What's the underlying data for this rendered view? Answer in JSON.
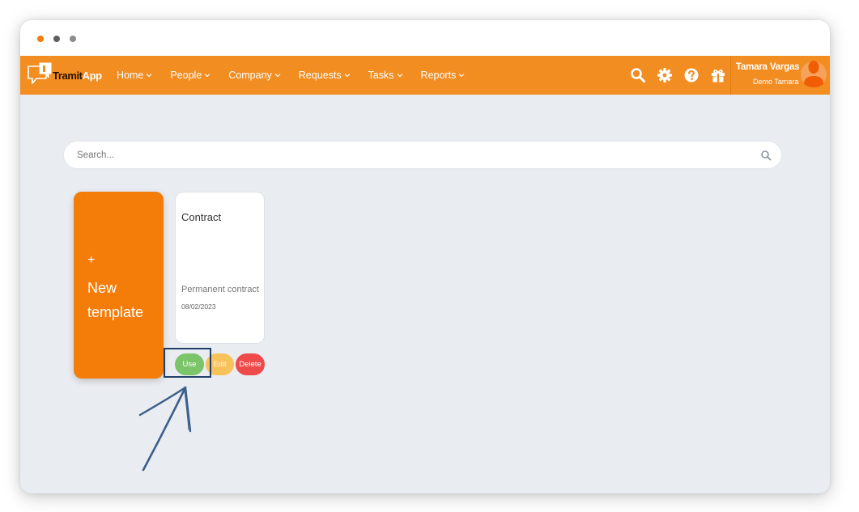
{
  "window": {
    "traffic_lights": [
      "#f07c0b",
      "#5e5e5e",
      "#8c8c8c"
    ]
  },
  "brand": {
    "name_part1": "Tramit",
    "name_part2": "App",
    "color": "#f28d22"
  },
  "nav": {
    "items": [
      {
        "label": "Home",
        "icon": "chevron-down-icon"
      },
      {
        "label": "People",
        "icon": "chevron-down-icon"
      },
      {
        "label": "Company",
        "icon": "chevron-down-icon"
      },
      {
        "label": "Requests",
        "icon": "chevron-down-icon"
      },
      {
        "label": "Tasks",
        "icon": "chevron-down-icon"
      },
      {
        "label": "Reports",
        "icon": "chevron-down-icon"
      }
    ],
    "icons": [
      "search-icon",
      "gear-icon",
      "help-icon",
      "gift-icon"
    ]
  },
  "user": {
    "name": "Tamara Vargas",
    "org": "Demo Tamara",
    "avatar_icon": "user-avatar-icon"
  },
  "search": {
    "placeholder": "Search...",
    "value": ""
  },
  "new_template": {
    "plus": "+",
    "label": "New template"
  },
  "templates": [
    {
      "title": "Contract",
      "description": "Permanent contract",
      "date": "08/02/2023",
      "actions": {
        "use": "Use",
        "edit": "Edit",
        "delete": "Delete"
      }
    }
  ],
  "colors": {
    "orange": "#f47c08",
    "use_green": "#7cc46a",
    "edit_yellow": "#f7c25a",
    "delete_red": "#ef4a4a",
    "annotation_blue": "#3a5f8a"
  }
}
